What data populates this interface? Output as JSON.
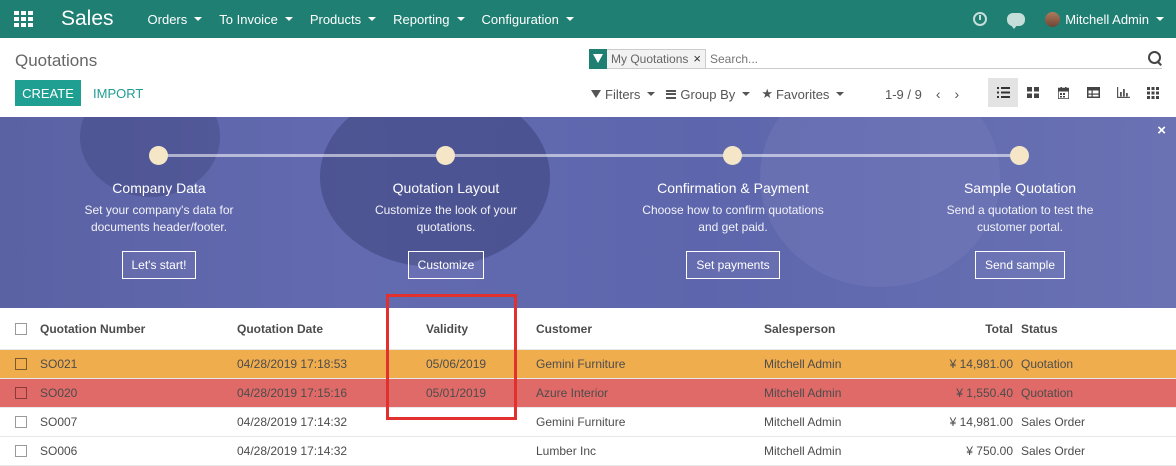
{
  "topbar": {
    "app_name": "Sales",
    "menu": [
      "Orders",
      "To Invoice",
      "Products",
      "Reporting",
      "Configuration"
    ],
    "user_name": "Mitchell Admin",
    "bg_color": "#1f7f73"
  },
  "control_panel": {
    "title": "Quotations",
    "search": {
      "facet": "My Quotations",
      "placeholder": "Search..."
    },
    "create_label": "CREATE",
    "import_label": "IMPORT",
    "filters_label": "Filters",
    "groupby_label": "Group By",
    "favorites_label": "Favorites",
    "pager": "1-9 / 9"
  },
  "banner": {
    "steps": [
      {
        "title": "Company Data",
        "desc1": "Set your company's data for",
        "desc2": "documents header/footer.",
        "button": "Let's start!"
      },
      {
        "title": "Quotation Layout",
        "desc1": "Customize the look of your",
        "desc2": "quotations.",
        "button": "Customize"
      },
      {
        "title": "Confirmation & Payment",
        "desc1": "Choose how to confirm quotations",
        "desc2": "and get paid.",
        "button": "Set payments"
      },
      {
        "title": "Sample Quotation",
        "desc1": "Send a quotation to test the",
        "desc2": "customer portal.",
        "button": "Send sample"
      }
    ],
    "close": "×"
  },
  "table": {
    "headers": {
      "number": "Quotation Number",
      "date": "Quotation Date",
      "validity": "Validity",
      "customer": "Customer",
      "salesperson": "Salesperson",
      "total": "Total",
      "status": "Status"
    },
    "rows": [
      {
        "number": "SO021",
        "date": "04/28/2019 17:18:53",
        "validity": "05/06/2019",
        "customer": "Gemini Furniture",
        "salesperson": "Mitchell Admin",
        "total": "¥ 14,981.00",
        "status": "Quotation",
        "row_color": "#f0ad4e"
      },
      {
        "number": "SO020",
        "date": "04/28/2019 17:15:16",
        "validity": "05/01/2019",
        "customer": "Azure Interior",
        "salesperson": "Mitchell Admin",
        "total": "¥ 1,550.40",
        "status": "Quotation",
        "row_color": "#e06a67"
      },
      {
        "number": "SO007",
        "date": "04/28/2019 17:14:32",
        "validity": "",
        "customer": "Gemini Furniture",
        "salesperson": "Mitchell Admin",
        "total": "¥ 14,981.00",
        "status": "Sales Order"
      },
      {
        "number": "SO006",
        "date": "04/28/2019 17:14:32",
        "validity": "",
        "customer": "Lumber Inc",
        "salesperson": "Mitchell Admin",
        "total": "¥ 750.00",
        "status": "Sales Order"
      }
    ]
  },
  "accent_color": "#1f9e92",
  "annotation_color": "#e2302f"
}
